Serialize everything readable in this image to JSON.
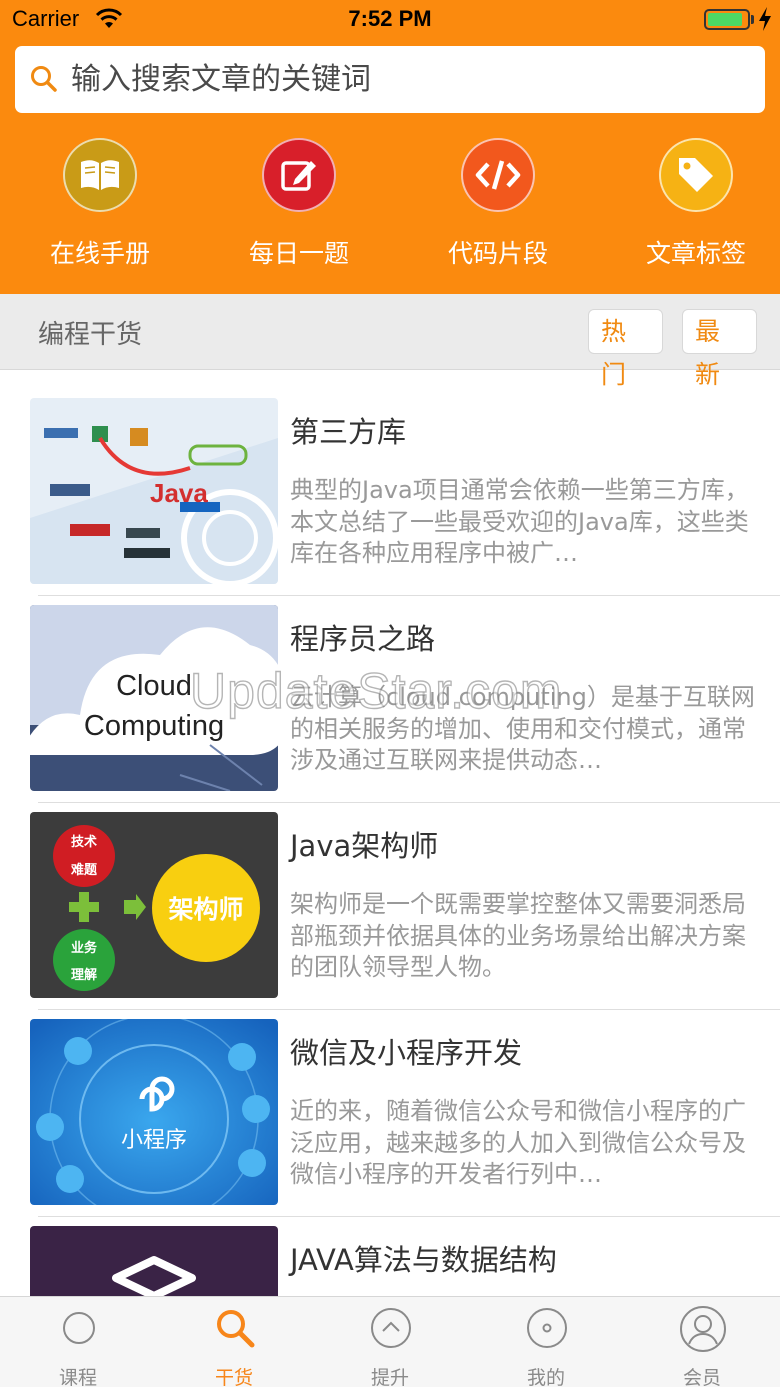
{
  "status_bar": {
    "carrier": "Carrier",
    "time": "7:52 PM",
    "battery_level": 0.9
  },
  "search": {
    "placeholder": "输入搜索文章的关键词",
    "value": ""
  },
  "shortcuts": [
    {
      "label": "在线手册",
      "icon": "book-icon",
      "color": "#c99b17"
    },
    {
      "label": "每日一题",
      "icon": "edit-icon",
      "color": "#d81f2a"
    },
    {
      "label": "代码片段",
      "icon": "code-icon",
      "color": "#f2581d"
    },
    {
      "label": "文章标签",
      "icon": "tag-icon",
      "color": "#f6b214"
    }
  ],
  "section": {
    "title": "编程干货",
    "sort_hot": "热门",
    "sort_new": "最新"
  },
  "articles": [
    {
      "title": "第三方库",
      "description": "典型的Java项目通常会依赖一些第三方库，本文总结了一些最受欢迎的Java库，这些类库在各种应用程序中被广…",
      "thumbnail_text": "Java"
    },
    {
      "title": "程序员之路",
      "description": "云计算（cloud computing）是基于互联网的相关服务的增加、使用和交付模式，通常涉及通过互联网来提供动态…",
      "thumbnail_text": "Cloud Computing"
    },
    {
      "title": "Java架构师",
      "description": "架构师是一个既需要掌控整体又需要洞悉局部瓶颈并依据具体的业务场景给出解决方案的团队领导型人物。",
      "thumbnail_text": "架构师",
      "thumb_tags": [
        "技术",
        "难题",
        "业务",
        "理解"
      ]
    },
    {
      "title": "微信及小程序开发",
      "description": "近的来，随着微信公众号和微信小程序的广泛应用，越来越多的人加入到微信公众号及微信小程序的开发者行列中…",
      "thumbnail_text": "小程序"
    },
    {
      "title": "JAVA算法与数据结构",
      "description": "",
      "thumbnail_text": ""
    }
  ],
  "watermark": "UpdateStar.com",
  "tabbar": [
    {
      "label": "课程",
      "icon": "circle-icon",
      "active": false
    },
    {
      "label": "干货",
      "icon": "search-icon",
      "active": true
    },
    {
      "label": "提升",
      "icon": "chevron-up-circle-icon",
      "active": false
    },
    {
      "label": "我的",
      "icon": "disc-icon",
      "active": false
    },
    {
      "label": "会员",
      "icon": "user-icon",
      "active": false
    }
  ],
  "colors": {
    "brand_orange": "#fb8a0e",
    "active_tab": "#f7861a"
  }
}
